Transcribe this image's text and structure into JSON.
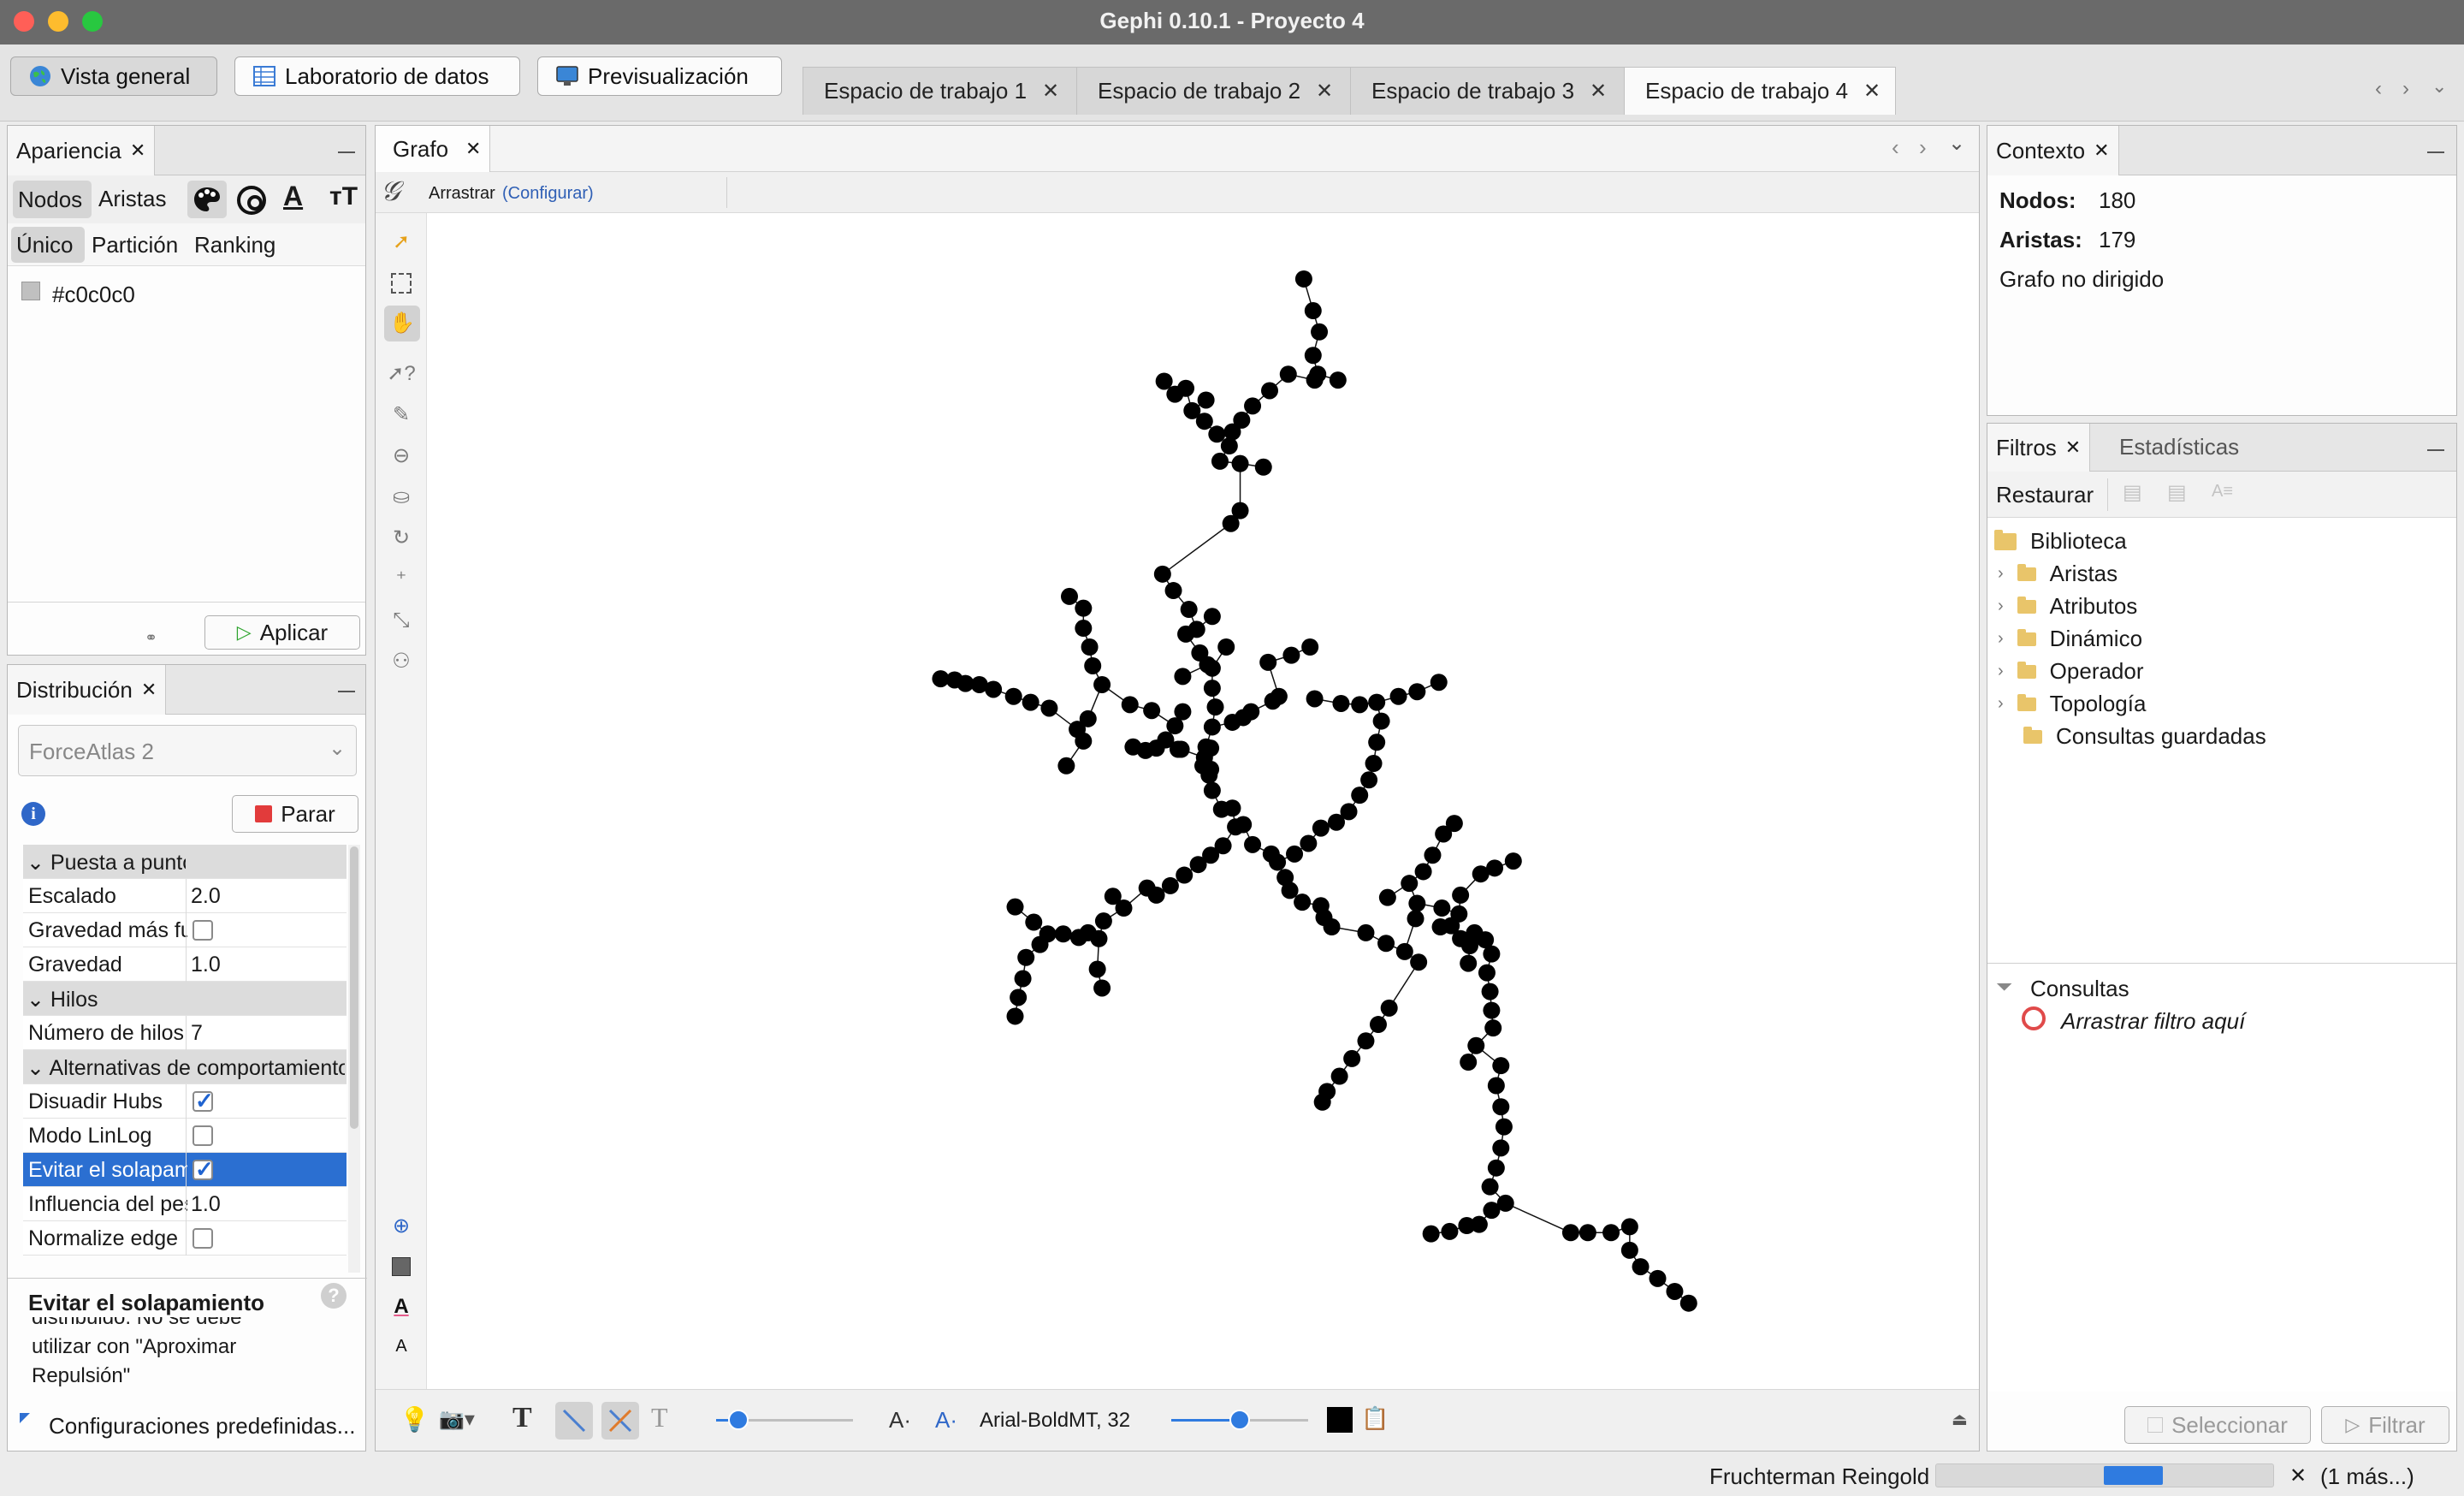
{
  "window": {
    "title": "Gephi 0.10.1 - Proyecto 4"
  },
  "modes": {
    "overview": "Vista general",
    "data_lab": "Laboratorio de datos",
    "preview": "Previsualización"
  },
  "workspaces": [
    "Espacio de trabajo 1",
    "Espacio de trabajo 2",
    "Espacio de trabajo 3",
    "Espacio de trabajo 4"
  ],
  "appearance": {
    "tab": "Apariencia",
    "sub": {
      "nodes": "Nodos",
      "edges": "Aristas"
    },
    "modes": {
      "unique": "Único",
      "partition": "Partición",
      "ranking": "Ranking"
    },
    "color_value": "#c0c0c0",
    "apply": "Aplicar"
  },
  "layout": {
    "tab": "Distribución",
    "algorithm": "ForceAtlas 2",
    "stop": "Parar",
    "groups": {
      "tuning": "Puesta a punto",
      "threads": "Hilos",
      "behavior": "Alternativas de comportamiento"
    },
    "props": {
      "scaling_k": "Escalado",
      "scaling_v": "2.0",
      "strong_gravity_k": "Gravedad más fuerte",
      "gravity_k": "Gravedad",
      "gravity_v": "1.0",
      "threads_k": "Número de hilos",
      "threads_v": "7",
      "dissuade_k": "Disuadir Hubs",
      "linlog_k": "Modo LinLog",
      "overlap_k": "Evitar el solapamiento",
      "edge_weight_k": "Influencia del peso",
      "edge_weight_v": "1.0",
      "normalize_k": "Normalize edge"
    },
    "desc_title": "Evitar el solapamiento",
    "desc_text": "distribuido. No se debe utilizar con \"Aproximar Repulsión\"",
    "presets": "Configuraciones predefinidas..."
  },
  "graph": {
    "tab": "Grafo",
    "tool": "Arrastrar",
    "configure": "(Configurar)",
    "font": "Arial-BoldMT, 32",
    "nodes": [
      [
        0.565,
        0.056
      ],
      [
        0.571,
        0.083
      ],
      [
        0.575,
        0.101
      ],
      [
        0.571,
        0.121
      ],
      [
        0.574,
        0.137
      ],
      [
        0.587,
        0.142
      ],
      [
        0.572,
        0.142
      ],
      [
        0.555,
        0.137
      ],
      [
        0.543,
        0.151
      ],
      [
        0.532,
        0.164
      ],
      [
        0.525,
        0.176
      ],
      [
        0.519,
        0.186
      ],
      [
        0.517,
        0.198
      ],
      [
        0.511,
        0.211
      ],
      [
        0.524,
        0.213
      ],
      [
        0.539,
        0.216
      ],
      [
        0.502,
        0.159
      ],
      [
        0.489,
        0.149
      ],
      [
        0.475,
        0.143
      ],
      [
        0.482,
        0.154
      ],
      [
        0.493,
        0.168
      ],
      [
        0.501,
        0.177
      ],
      [
        0.509,
        0.188
      ],
      [
        0.524,
        0.253
      ],
      [
        0.518,
        0.264
      ],
      [
        0.474,
        0.307
      ],
      [
        0.481,
        0.321
      ],
      [
        0.491,
        0.337
      ],
      [
        0.496,
        0.354
      ],
      [
        0.506,
        0.343
      ],
      [
        0.489,
        0.358
      ],
      [
        0.498,
        0.374
      ],
      [
        0.506,
        0.387
      ],
      [
        0.506,
        0.404
      ],
      [
        0.508,
        0.42
      ],
      [
        0.506,
        0.437
      ],
      [
        0.505,
        0.455
      ],
      [
        0.505,
        0.473
      ],
      [
        0.506,
        0.491
      ],
      [
        0.512,
        0.507
      ],
      [
        0.521,
        0.522
      ],
      [
        0.532,
        0.537
      ],
      [
        0.544,
        0.545
      ],
      [
        0.542,
        0.382
      ],
      [
        0.557,
        0.376
      ],
      [
        0.569,
        0.369
      ],
      [
        0.545,
        0.415
      ],
      [
        0.531,
        0.424
      ],
      [
        0.519,
        0.433
      ],
      [
        0.526,
        0.429
      ],
      [
        0.549,
        0.411
      ],
      [
        0.572,
        0.413
      ],
      [
        0.589,
        0.417
      ],
      [
        0.601,
        0.418
      ],
      [
        0.612,
        0.416
      ],
      [
        0.626,
        0.411
      ],
      [
        0.638,
        0.407
      ],
      [
        0.652,
        0.399
      ],
      [
        0.615,
        0.432
      ],
      [
        0.612,
        0.45
      ],
      [
        0.61,
        0.468
      ],
      [
        0.607,
        0.482
      ],
      [
        0.601,
        0.495
      ],
      [
        0.594,
        0.509
      ],
      [
        0.586,
        0.518
      ],
      [
        0.576,
        0.523
      ],
      [
        0.568,
        0.536
      ],
      [
        0.559,
        0.545
      ],
      [
        0.515,
        0.369
      ],
      [
        0.503,
        0.384
      ],
      [
        0.487,
        0.394
      ],
      [
        0.487,
        0.424
      ],
      [
        0.482,
        0.436
      ],
      [
        0.476,
        0.448
      ],
      [
        0.486,
        0.456
      ],
      [
        0.502,
        0.454
      ],
      [
        0.414,
        0.326
      ],
      [
        0.423,
        0.336
      ],
      [
        0.423,
        0.353
      ],
      [
        0.427,
        0.369
      ],
      [
        0.429,
        0.385
      ],
      [
        0.435,
        0.401
      ],
      [
        0.453,
        0.418
      ],
      [
        0.467,
        0.423
      ],
      [
        0.426,
        0.43
      ],
      [
        0.419,
        0.439
      ],
      [
        0.423,
        0.449
      ],
      [
        0.412,
        0.47
      ],
      [
        0.401,
        0.421
      ],
      [
        0.389,
        0.416
      ],
      [
        0.378,
        0.411
      ],
      [
        0.365,
        0.405
      ],
      [
        0.356,
        0.401
      ],
      [
        0.347,
        0.4
      ],
      [
        0.34,
        0.397
      ],
      [
        0.331,
        0.396
      ],
      [
        0.455,
        0.454
      ],
      [
        0.463,
        0.457
      ],
      [
        0.47,
        0.455
      ],
      [
        0.484,
        0.456
      ],
      [
        0.501,
        0.463
      ],
      [
        0.5,
        0.47
      ],
      [
        0.504,
        0.478
      ],
      [
        0.519,
        0.506
      ],
      [
        0.526,
        0.52
      ],
      [
        0.513,
        0.538
      ],
      [
        0.505,
        0.546
      ],
      [
        0.497,
        0.554
      ],
      [
        0.488,
        0.563
      ],
      [
        0.479,
        0.572
      ],
      [
        0.47,
        0.58
      ],
      [
        0.464,
        0.574
      ],
      [
        0.442,
        0.581
      ],
      [
        0.449,
        0.591
      ],
      [
        0.436,
        0.602
      ],
      [
        0.426,
        0.612
      ],
      [
        0.42,
        0.616
      ],
      [
        0.41,
        0.613
      ],
      [
        0.4,
        0.613
      ],
      [
        0.391,
        0.603
      ],
      [
        0.395,
        0.622
      ],
      [
        0.386,
        0.633
      ],
      [
        0.384,
        0.651
      ],
      [
        0.381,
        0.667
      ],
      [
        0.379,
        0.683
      ],
      [
        0.379,
        0.59
      ],
      [
        0.433,
        0.617
      ],
      [
        0.432,
        0.643
      ],
      [
        0.435,
        0.659
      ],
      [
        0.548,
        0.552
      ],
      [
        0.553,
        0.565
      ],
      [
        0.556,
        0.576
      ],
      [
        0.564,
        0.586
      ],
      [
        0.576,
        0.589
      ],
      [
        0.578,
        0.599
      ],
      [
        0.583,
        0.607
      ],
      [
        0.605,
        0.612
      ],
      [
        0.618,
        0.621
      ],
      [
        0.63,
        0.628
      ],
      [
        0.639,
        0.637
      ],
      [
        0.62,
        0.676
      ],
      [
        0.613,
        0.69
      ],
      [
        0.605,
        0.704
      ],
      [
        0.596,
        0.719
      ],
      [
        0.588,
        0.734
      ],
      [
        0.58,
        0.747
      ],
      [
        0.577,
        0.756
      ],
      [
        0.662,
        0.519
      ],
      [
        0.655,
        0.528
      ],
      [
        0.648,
        0.546
      ],
      [
        0.642,
        0.56
      ],
      [
        0.633,
        0.57
      ],
      [
        0.619,
        0.582
      ],
      [
        0.638,
        0.587
      ],
      [
        0.654,
        0.591
      ],
      [
        0.637,
        0.6
      ],
      [
        0.653,
        0.607
      ],
      [
        0.666,
        0.617
      ],
      [
        0.672,
        0.623
      ],
      [
        0.686,
        0.63
      ],
      [
        0.683,
        0.646
      ],
      [
        0.685,
        0.662
      ],
      [
        0.686,
        0.678
      ],
      [
        0.687,
        0.693
      ],
      [
        0.676,
        0.708
      ],
      [
        0.671,
        0.722
      ],
      [
        0.692,
        0.725
      ],
      [
        0.689,
        0.742
      ],
      [
        0.692,
        0.76
      ],
      [
        0.694,
        0.777
      ],
      [
        0.692,
        0.795
      ],
      [
        0.689,
        0.812
      ],
      [
        0.685,
        0.828
      ],
      [
        0.695,
        0.842
      ],
      [
        0.686,
        0.848
      ],
      [
        0.678,
        0.86
      ],
      [
        0.67,
        0.861
      ],
      [
        0.659,
        0.866
      ],
      [
        0.647,
        0.868
      ],
      [
        0.737,
        0.867
      ],
      [
        0.748,
        0.867
      ],
      [
        0.763,
        0.867
      ],
      [
        0.775,
        0.862
      ],
      [
        0.775,
        0.882
      ],
      [
        0.782,
        0.896
      ],
      [
        0.793,
        0.906
      ],
      [
        0.804,
        0.917
      ],
      [
        0.813,
        0.927
      ],
      [
        0.7,
        0.551
      ],
      [
        0.688,
        0.557
      ],
      [
        0.679,
        0.562
      ],
      [
        0.666,
        0.58
      ],
      [
        0.665,
        0.596
      ],
      [
        0.66,
        0.606
      ],
      [
        0.675,
        0.612
      ],
      [
        0.682,
        0.618
      ],
      [
        0.671,
        0.638
      ]
    ]
  },
  "context": {
    "tab": "Contexto",
    "nodes_label": "Nodos:",
    "nodes_value": "180",
    "edges_label": "Aristas:",
    "edges_value": "179",
    "type": "Grafo no dirigido"
  },
  "filters": {
    "tab": "Filtros",
    "stats_tab": "Estadísticas",
    "reset": "Restaurar",
    "library": "Biblioteca",
    "items": [
      "Aristas",
      "Atributos",
      "Dinámico",
      "Operador",
      "Topología",
      "Consultas guardadas"
    ],
    "queries": "Consultas",
    "drop_hint": "Arrastrar filtro aquí",
    "select_btn": "Seleccionar",
    "filter_btn": "Filtrar"
  },
  "status": {
    "task": "Fruchterman Reingold",
    "more": "(1 más...)",
    "progress": 0.35
  }
}
